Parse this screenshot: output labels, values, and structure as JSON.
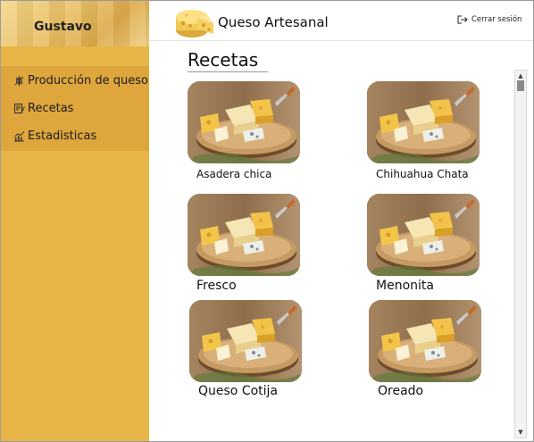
{
  "sidebar": {
    "user_name": "Gustavo",
    "items": [
      {
        "label": "Producción de queso",
        "icon": "cheese-production-icon"
      },
      {
        "label": "Recetas",
        "icon": "recipe-icon"
      },
      {
        "label": "Estadisticas",
        "icon": "chart-icon"
      }
    ]
  },
  "header": {
    "title": "Queso Artesanal",
    "logout_label": "Cerrar sesión"
  },
  "main": {
    "section_title": "Recetas",
    "recipes": [
      {
        "name": "Asadera chica"
      },
      {
        "name": "Chihuahua Chata"
      },
      {
        "name": "Fresco"
      },
      {
        "name": "Menonita"
      },
      {
        "name": "Queso Cotija"
      },
      {
        "name": "Oreado"
      }
    ]
  },
  "colors": {
    "sidebar": "#e7b547",
    "nav_block": "#dea63c",
    "accent": "#e0a83f"
  }
}
